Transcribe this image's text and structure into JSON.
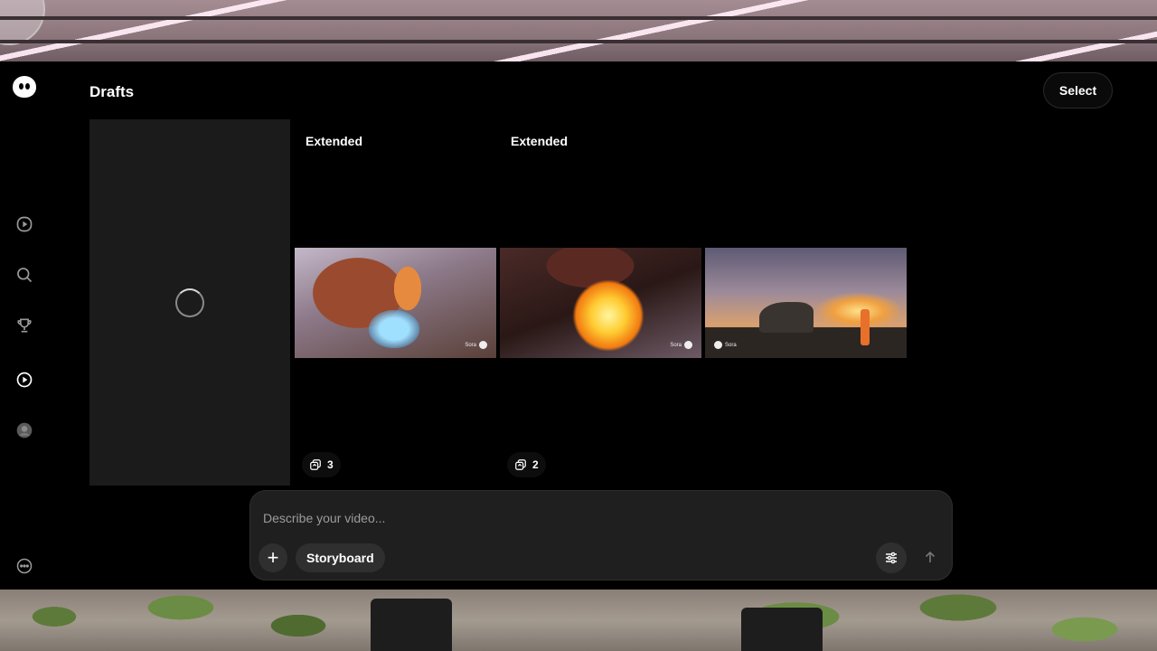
{
  "page": {
    "title": "Drafts"
  },
  "header": {
    "select_label": "Select"
  },
  "sidebar": {
    "items": [
      {
        "name": "video",
        "icon": "play-circle-icon"
      },
      {
        "name": "search",
        "icon": "search-icon"
      },
      {
        "name": "trophy",
        "icon": "trophy-icon"
      },
      {
        "name": "drafts",
        "icon": "play-circle-filled-icon"
      },
      {
        "name": "profile",
        "icon": "avatar-icon"
      },
      {
        "name": "more",
        "icon": "more-icon"
      }
    ]
  },
  "drafts": [
    {
      "tag": "Extended",
      "count": "3",
      "watermark": "Sora"
    },
    {
      "tag": "Extended",
      "count": "2",
      "watermark": "Sora"
    },
    {
      "tag": "",
      "count": "",
      "watermark": "Sora"
    }
  ],
  "composer": {
    "placeholder": "Describe your video...",
    "storyboard_label": "Storyboard",
    "add_label": "+"
  },
  "colors": {
    "background": "#000000",
    "panel": "#1f1f1f",
    "card": "#1b1b1b"
  }
}
